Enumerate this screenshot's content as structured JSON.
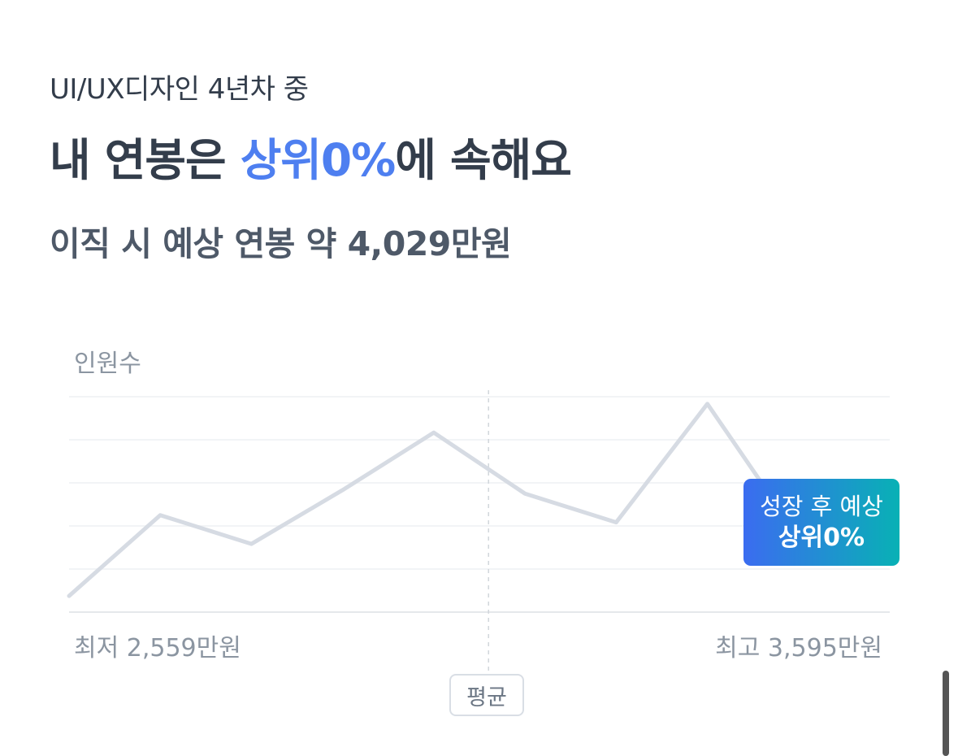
{
  "header": {
    "subtitle": "UI/UX디자인 4년차 중",
    "headline_prefix": "내 연봉은 ",
    "headline_accent": "상위0%",
    "headline_suffix": "에 속해요",
    "expected_salary": "이직 시 예상 연봉 약 4,029만원"
  },
  "chart_data": {
    "type": "line",
    "ylabel": "인원수",
    "x_min_label": "최저 2,559만원",
    "x_max_label": "최고 3,595만원",
    "average_label": "평균",
    "x": [
      0,
      1,
      2,
      3,
      4,
      5,
      6,
      7,
      8,
      9
    ],
    "values": [
      0.9,
      5.4,
      3.8,
      6.8,
      10.0,
      6.6,
      5.0,
      11.6,
      4.2,
      6.6
    ],
    "ylim": [
      0,
      12
    ],
    "grid": true,
    "line_color": "#d6dbe3",
    "highlight_color": "#4e7ff0",
    "average_x": 4.6,
    "highlight_point": {
      "x": 9,
      "value": 6.6
    },
    "tooltip": {
      "line1": "성장 후 예상",
      "line2": "상위0%"
    }
  }
}
